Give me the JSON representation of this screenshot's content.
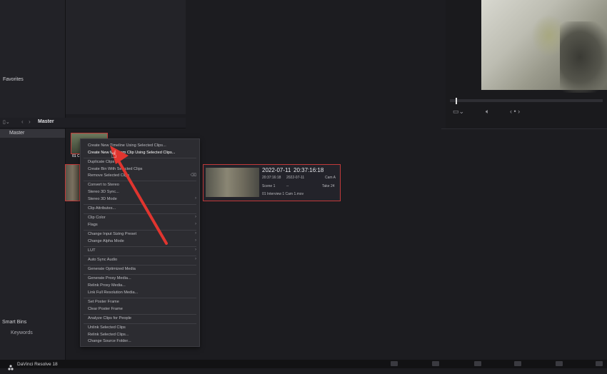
{
  "sidebar": {
    "favorites_label": "Favorites",
    "master_label": "Master",
    "smart_bins_label": "Smart Bins",
    "keywords_label": "Keywords"
  },
  "bin_header": {
    "title": "Master"
  },
  "clips": {
    "first_label": "01 C"
  },
  "selected_clip": {
    "date": "2022-07-11",
    "timecode": "20:37:16:18",
    "start_tc": "20:37:16:18",
    "date_small": "2022-07-11",
    "camera": "Cam A",
    "scene": "Scene 1",
    "dash": "--",
    "take": "Take 24",
    "filename": "01 Interview 1 Cam 1.mov"
  },
  "context_menu": {
    "items": [
      {
        "label": "Create New Timeline Using Selected Clips..."
      },
      {
        "label": "Create New Multicam Clip Using Selected Clips..."
      },
      {
        "label": "Duplicate Clips"
      },
      {
        "label": "Create Bin With Selected Clips"
      },
      {
        "label": "Remove Selected Clips"
      },
      {
        "label": "Convert to Stereo"
      },
      {
        "label": "Stereo 3D Sync..."
      },
      {
        "label": "Stereo 3D Mode"
      },
      {
        "label": "Clip Attributes..."
      },
      {
        "label": "Clip Color"
      },
      {
        "label": "Flags"
      },
      {
        "label": "Change Input Sizing Preset"
      },
      {
        "label": "Change Alpha Mode"
      },
      {
        "label": "LUT"
      },
      {
        "label": "Auto Sync Audio"
      },
      {
        "label": "Generate Optimized Media"
      },
      {
        "label": "Generate Proxy Media..."
      },
      {
        "label": "Relink Proxy Media..."
      },
      {
        "label": "Link Full Resolution Media..."
      },
      {
        "label": "Set Poster Frame"
      },
      {
        "label": "Clear Poster Frame"
      },
      {
        "label": "Analyze Clips for People"
      },
      {
        "label": "Unlink Selected Clips"
      },
      {
        "label": "Relink Selected Clips..."
      },
      {
        "label": "Change Source Folder..."
      }
    ],
    "remove_shortcut": "⌫"
  },
  "taskbar": {
    "app_name": "DaVinci Resolve 18"
  },
  "colors": {
    "accent_red": "#c23a3a",
    "arrow_red": "#e0352f",
    "background": "#1c1c20"
  }
}
